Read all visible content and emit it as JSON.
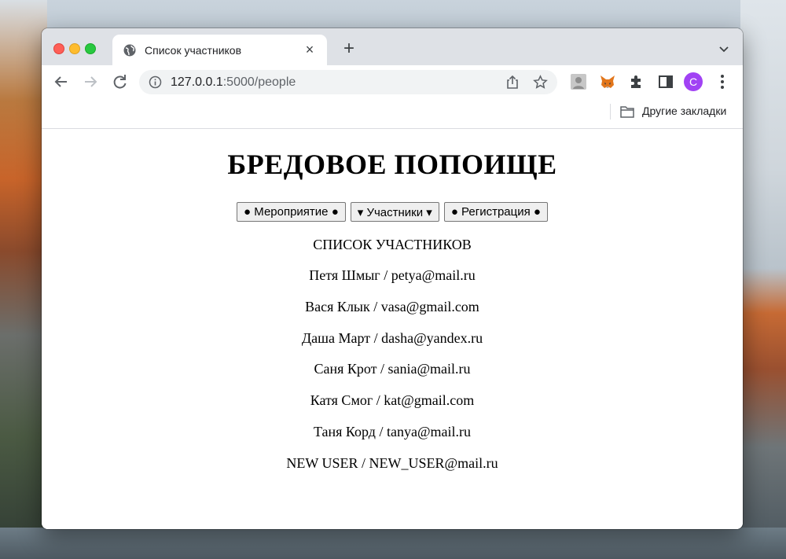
{
  "browser": {
    "tab_title": "Список участников",
    "new_tab_symbol": "+",
    "close_symbol": "×",
    "url_host": "127.0.0.1",
    "url_path": ":5000/people",
    "avatar_letter": "C",
    "bookmarks": {
      "other_label": "Другие закладки"
    },
    "icons": [
      "globe-icon",
      "back-icon",
      "forward-icon",
      "reload-icon",
      "info-icon",
      "share-icon",
      "star-icon",
      "extension-profile-icon",
      "metamask-fox-icon",
      "puzzle-icon",
      "side-panel-icon",
      "menu-dots-icon",
      "folder-icon",
      "tab-search-icon"
    ]
  },
  "page": {
    "title": "БРЕДОВОЕ ПОПОИЩЕ",
    "nav": {
      "events": "● Мероприятие ●",
      "participants": "▾ Участники ▾",
      "registration": "● Регистрация ●"
    },
    "section_title": "СПИСОК УЧАСТНИКОВ",
    "people": [
      "Петя Шмыг / petya@mail.ru",
      "Вася Клык / vasa@gmail.com",
      "Даша Март / dasha@yandex.ru",
      "Саня Крот / sania@mail.ru",
      "Катя Смог / kat@gmail.com",
      "Таня Корд / tanya@mail.ru",
      "NEW USER / NEW_USER@mail.ru"
    ]
  },
  "colors": {
    "accent_avatar": "#a142f4",
    "tabstrip": "#dee1e6",
    "omnibox": "#f1f3f4"
  }
}
